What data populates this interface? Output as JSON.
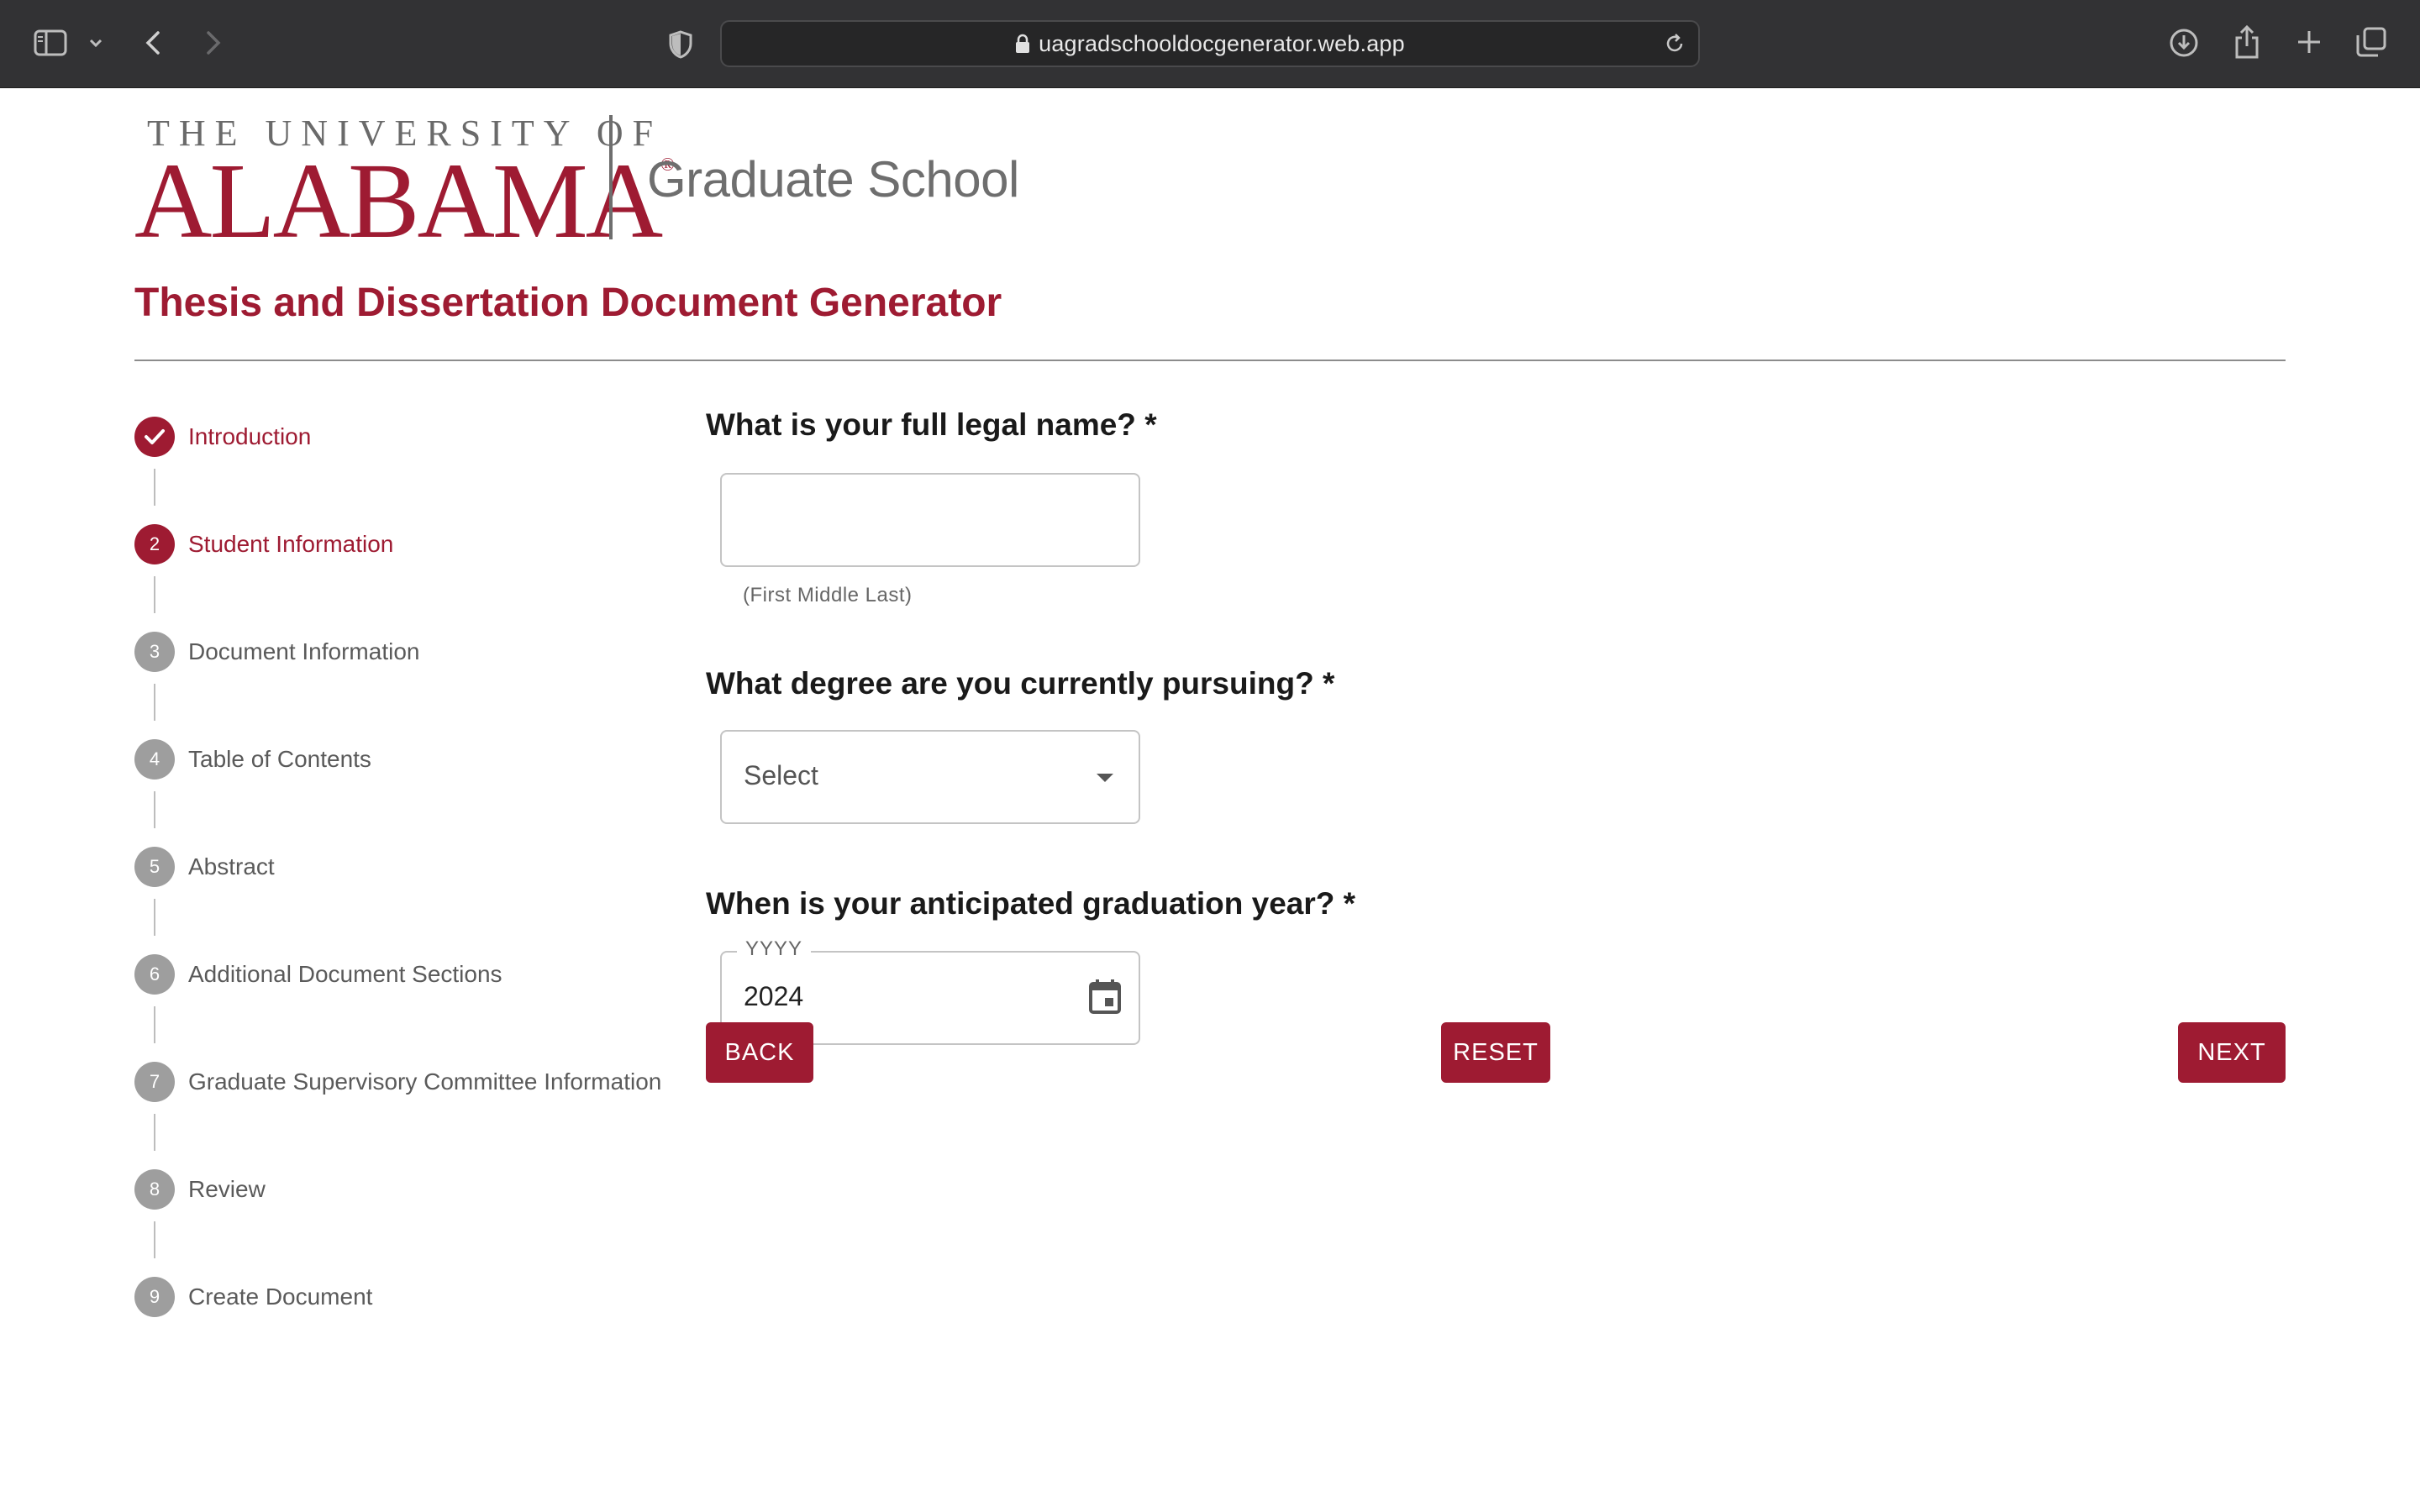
{
  "browser": {
    "url": "uagradschooldocgenerator.web.app",
    "icons": [
      "sidebar-icon",
      "chevron-down-icon",
      "back-arrow-icon",
      "forward-arrow-icon",
      "shield-icon",
      "lock-icon",
      "reload-icon",
      "download-icon",
      "share-icon",
      "new-tab-icon",
      "tab-overview-icon"
    ]
  },
  "header": {
    "logo_top": "THE UNIVERSITY OF",
    "logo_main": "ALABAMA",
    "logo_reg": "®",
    "logo_sub": "Graduate School",
    "title": "Thesis and Dissertation Document Generator"
  },
  "stepper": {
    "steps": [
      {
        "number": "1",
        "label": "Introduction",
        "state": "done"
      },
      {
        "number": "2",
        "label": "Student Information",
        "state": "active"
      },
      {
        "number": "3",
        "label": "Document Information",
        "state": "todo"
      },
      {
        "number": "4",
        "label": "Table of Contents",
        "state": "todo"
      },
      {
        "number": "5",
        "label": "Abstract",
        "state": "todo"
      },
      {
        "number": "6",
        "label": "Additional Document Sections",
        "state": "todo"
      },
      {
        "number": "7",
        "label": "Graduate Supervisory Committee Information",
        "state": "todo"
      },
      {
        "number": "8",
        "label": "Review",
        "state": "todo"
      },
      {
        "number": "9",
        "label": "Create Document",
        "state": "todo"
      }
    ]
  },
  "form": {
    "name_question": "What is your full legal name? *",
    "name_value": "",
    "name_helper": "(First Middle Last)",
    "degree_question": "What degree are you currently pursuing? *",
    "degree_selected": "Select",
    "year_question": "When is your anticipated graduation year? *",
    "year_label": "YYYY",
    "year_value": "2024"
  },
  "buttons": {
    "back": "BACK",
    "reset": "RESET",
    "next": "NEXT"
  },
  "colors": {
    "brand": "#9e1b32",
    "inactive": "#9e9e9e",
    "chrome": "#323234"
  }
}
